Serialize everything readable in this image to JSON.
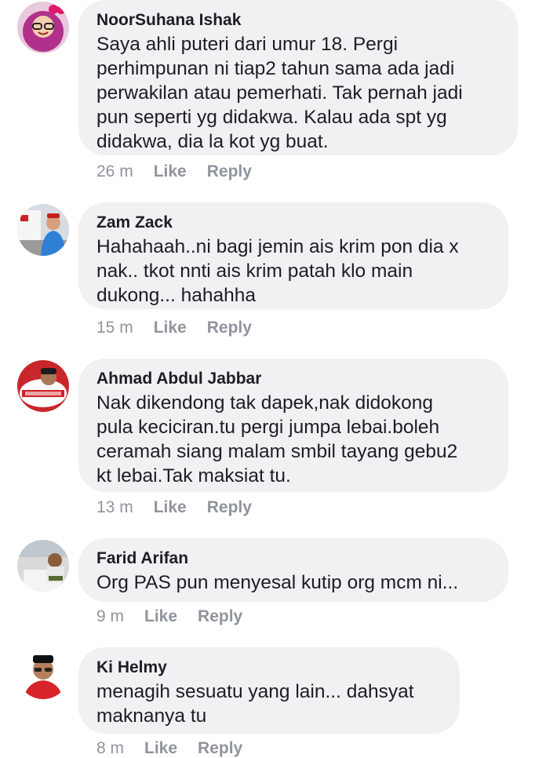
{
  "comments": [
    {
      "author": "NoorSuhana Ishak",
      "text": "Saya ahli puteri dari umur 18. Pergi\nperhimpunan ni tiap2 tahun sama ada jadi\nperwakilan atau pemerhati. Tak pernah jadi\npun seperti yg didakwa. Kalau ada spt yg\ndidakwa, dia la kot yg buat.",
      "time": "26 m",
      "like": "Like",
      "reply": "Reply"
    },
    {
      "author": "Zam Zack",
      "text": "Hahahaah..ni bagi jemin ais krim pon dia x\nnak.. tkot nnti ais krim patah klo main\ndukong... hahahha",
      "time": "15 m",
      "like": "Like",
      "reply": "Reply"
    },
    {
      "author": "Ahmad Abdul Jabbar",
      "text": "Nak dikendong tak dapek,nak didokong\npula keciciran.tu pergi jumpa lebai.boleh\nceramah siang malam smbil tayang gebu2\nkt lebai.Tak maksiat tu.",
      "time": "13 m",
      "like": "Like",
      "reply": "Reply"
    },
    {
      "author": "Farid Arifan",
      "text": "Org PAS pun menyesal kutip org mcm ni...",
      "time": "9 m",
      "like": "Like",
      "reply": "Reply"
    },
    {
      "author": "Ki Helmy",
      "text": "menagih sesuatu yang lain... dahsyat\nmaknanya tu",
      "time": "8 m",
      "like": "Like",
      "reply": "Reply"
    }
  ]
}
